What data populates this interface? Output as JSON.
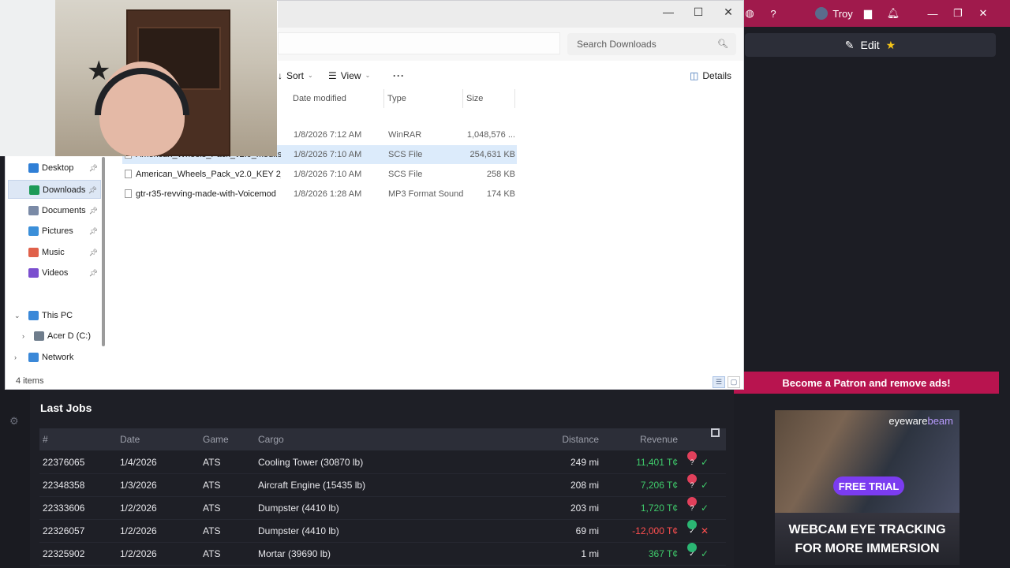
{
  "explorer": {
    "window_controls": {
      "minimize": "—",
      "maximize": "☐",
      "close": "✕"
    },
    "search_placeholder": "Search Downloads",
    "toolbar": {
      "sort": "Sort",
      "view": "View",
      "more": "···",
      "details": "Details"
    },
    "columns": {
      "date_modified": "Date modified",
      "type": "Type",
      "size": "Size"
    },
    "files": [
      {
        "name": "",
        "date": "1/8/2026 7:12 AM",
        "type": "WinRAR",
        "size": "1,048,576 ..."
      },
      {
        "name": "American_Wheels_Pack_v2.0_modl.scs",
        "date": "1/8/2026 7:10 AM",
        "type": "SCS File",
        "size": "254,631 KB"
      },
      {
        "name": "American_Wheels_Pack_v2.0_KEY 2_modl...",
        "date": "1/8/2026 7:10 AM",
        "type": "SCS File",
        "size": "258 KB"
      },
      {
        "name": "gtr-r35-revving-made-with-Voicemod",
        "date": "1/8/2026 1:28 AM",
        "type": "MP3 Format Sound",
        "size": "174 KB"
      }
    ],
    "nav": [
      {
        "label": "Desktop",
        "icon": "desktop-icon",
        "color": "#2f7fd6"
      },
      {
        "label": "Downloads",
        "icon": "downloads-icon",
        "color": "#1d9a57"
      },
      {
        "label": "Documents",
        "icon": "documents-icon",
        "color": "#7a8aa6"
      },
      {
        "label": "Pictures",
        "icon": "pictures-icon",
        "color": "#3b8fd9"
      },
      {
        "label": "Music",
        "icon": "music-icon",
        "color": "#e0614a"
      },
      {
        "label": "Videos",
        "icon": "videos-icon",
        "color": "#7b4fcf"
      },
      {
        "label": "This PC",
        "icon": "pc-icon",
        "color": "#3a88d8"
      },
      {
        "label": "Acer D  (C:)",
        "icon": "drive-icon",
        "color": "#6f7d8c"
      },
      {
        "label": "Network",
        "icon": "network-icon",
        "color": "#3a88d8"
      }
    ],
    "status": "4 items"
  },
  "web": {
    "user": "Troy",
    "help": "?",
    "edit_label": "Edit",
    "patron_banner": "Become a Patron and remove ads!",
    "ad": {
      "brand_a": "eyeware",
      "brand_b": "beam",
      "cta": "FREE TRIAL",
      "headline_1": "WEBCAM EYE TRACKING",
      "headline_2": "FOR MORE IMMERSION"
    },
    "jobs_title": "Last Jobs",
    "jobs_columns": {
      "id": "#",
      "date": "Date",
      "game": "Game",
      "cargo": "Cargo",
      "distance": "Distance",
      "revenue": "Revenue"
    },
    "jobs": [
      {
        "id": "22376065",
        "date": "1/4/2026",
        "game": "ATS",
        "cargo": "Cooling Tower (30870 lb)",
        "distance": "249 mi",
        "revenue": "11,401 T¢",
        "positive": true
      },
      {
        "id": "22348358",
        "date": "1/3/2026",
        "game": "ATS",
        "cargo": "Aircraft Engine (15435 lb)",
        "distance": "208 mi",
        "revenue": "7,206 T¢",
        "positive": true
      },
      {
        "id": "22333606",
        "date": "1/2/2026",
        "game": "ATS",
        "cargo": "Dumpster (4410 lb)",
        "distance": "203 mi",
        "revenue": "1,720 T¢",
        "positive": true
      },
      {
        "id": "22326057",
        "date": "1/2/2026",
        "game": "ATS",
        "cargo": "Dumpster (4410 lb)",
        "distance": "69 mi",
        "revenue": "-12,000 T¢",
        "positive": false
      },
      {
        "id": "22325902",
        "date": "1/2/2026",
        "game": "ATS",
        "cargo": "Mortar (39690 lb)",
        "distance": "1 mi",
        "revenue": "367 T¢",
        "positive": true
      }
    ]
  }
}
